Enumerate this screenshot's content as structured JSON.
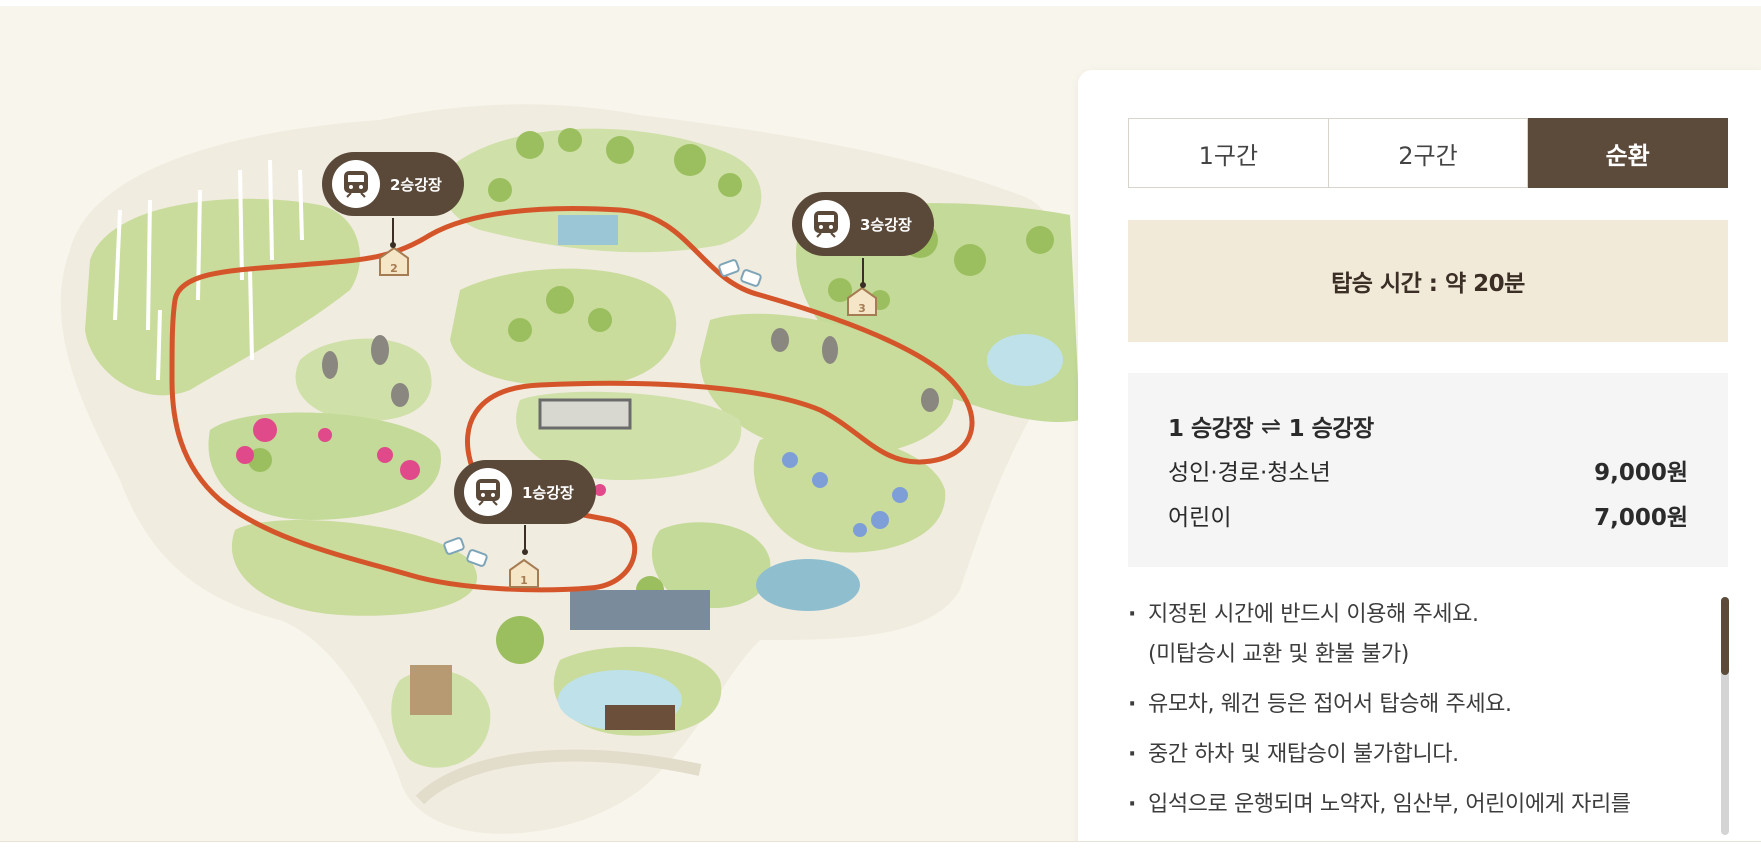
{
  "map": {
    "stations": [
      {
        "label": "2승강장",
        "marker": "2"
      },
      {
        "label": "3승강장",
        "marker": "3"
      },
      {
        "label": "1승강장",
        "marker": "1"
      }
    ],
    "route_color": "#d5552a",
    "station_icon": "train-icon"
  },
  "tabs": [
    {
      "label": "1구간",
      "active": false
    },
    {
      "label": "2구간",
      "active": false
    },
    {
      "label": "순환",
      "active": true
    }
  ],
  "ride_time": "탑승 시간 : 약 20분",
  "fare": {
    "from": "1 승강장",
    "arrow": "⇌",
    "to": "1 승강장",
    "rows": [
      {
        "label": "성인·경로·청소년",
        "price": "9,000원"
      },
      {
        "label": "어린이",
        "price": "7,000원"
      }
    ]
  },
  "notes": [
    {
      "line1": "지정된 시간에 반드시 이용해 주세요.",
      "line2": "(미탑승시 교환 및 환불 불가)"
    },
    {
      "line1": "유모차, 웨건 등은 접어서 탑승해 주세요."
    },
    {
      "line1": "중간 하차 및 재탑승이 불가합니다."
    },
    {
      "line1": "입석으로 운행되며 노약자, 임산부, 어린이에게 자리를"
    }
  ],
  "colors": {
    "brand_brown": "#5c4a3b",
    "time_bg": "#f2ead8",
    "fare_bg": "#f5f5f5",
    "page_bg": "#f8f5ec"
  }
}
